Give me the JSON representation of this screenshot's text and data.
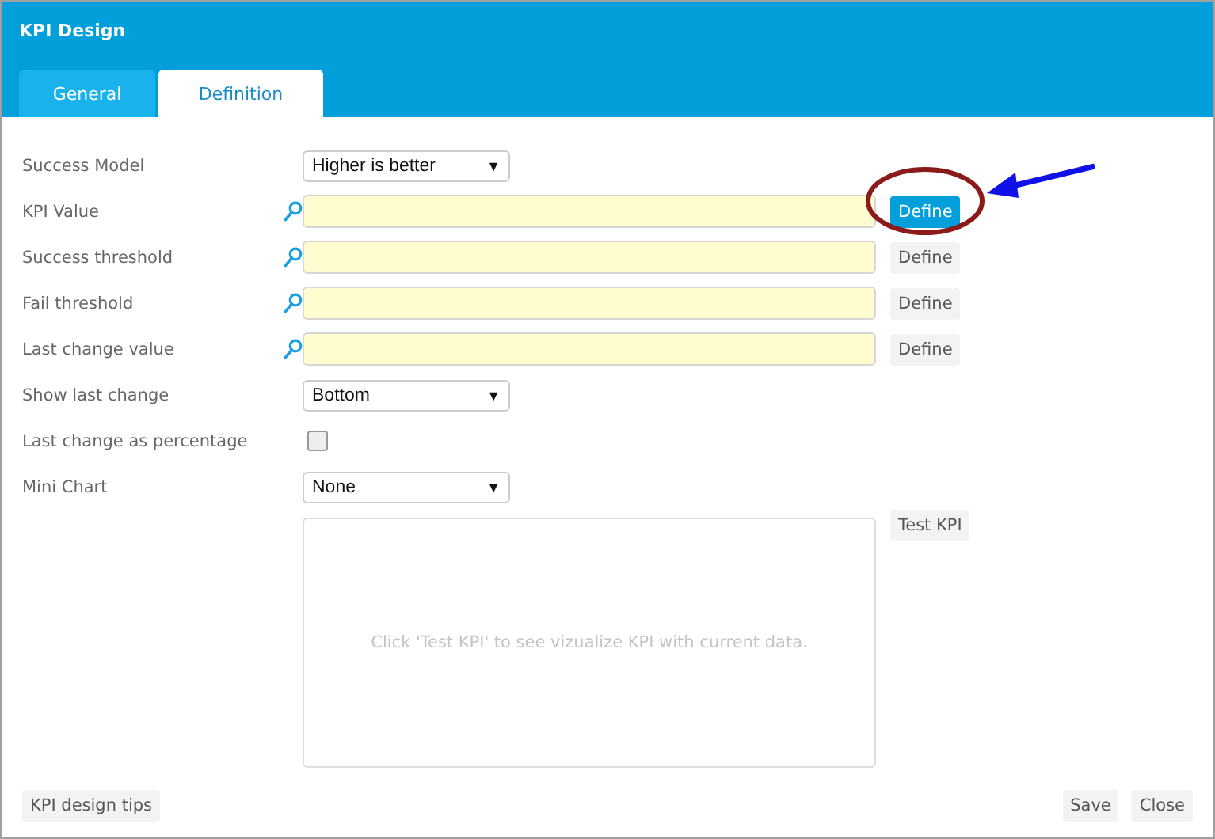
{
  "window": {
    "title": "KPI Design"
  },
  "tabs": [
    {
      "label": "General",
      "selected": false
    },
    {
      "label": "Definition",
      "selected": true
    }
  ],
  "fields": [
    {
      "kind": "select",
      "label": "Success Model",
      "value": "Higher is better",
      "arrow": "▼"
    },
    {
      "kind": "lookup",
      "label": "KPI Value",
      "button": "Define",
      "highlighted": true
    },
    {
      "kind": "lookup",
      "label": "Success threshold",
      "button": "Define",
      "highlighted": false
    },
    {
      "kind": "lookup",
      "label": "Fail threshold",
      "button": "Define",
      "highlighted": false
    },
    {
      "kind": "lookup",
      "label": "Last change value",
      "button": "Define",
      "highlighted": false
    },
    {
      "kind": "select",
      "label": "Show last change",
      "value": "Bottom",
      "arrow": "▼"
    },
    {
      "kind": "checkbox",
      "label": "Last change as percentage",
      "checked": false
    },
    {
      "kind": "select",
      "label": "Mini Chart",
      "value": "None",
      "arrow": "▼"
    }
  ],
  "preview": {
    "message": "Click 'Test KPI' to see vizualize KPI with current data.",
    "button": "Test KPI"
  },
  "footer": {
    "tips_button": "KPI design tips",
    "buttons": [
      "Save",
      "Close"
    ]
  }
}
